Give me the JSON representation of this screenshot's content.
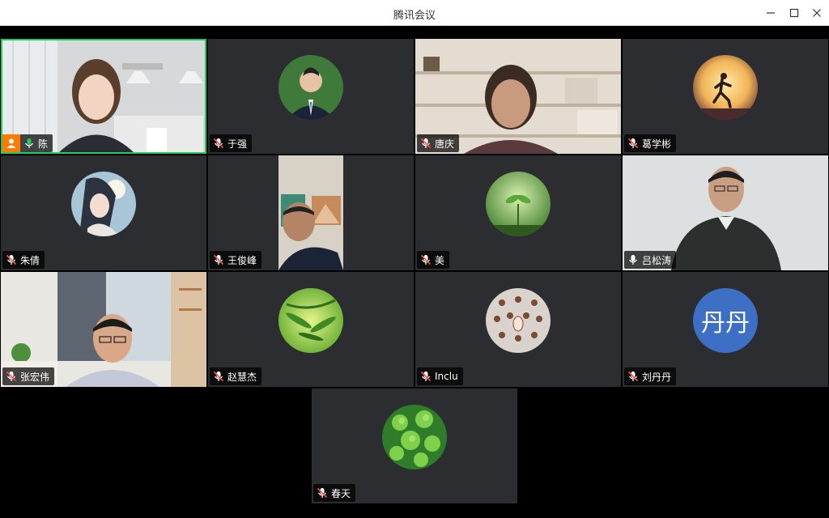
{
  "window": {
    "title": "腾讯会议",
    "minimize": "minimize-icon",
    "maximize": "maximize-icon",
    "close": "close-icon"
  },
  "participants": [
    {
      "name": "陈",
      "mic": "on",
      "host": true,
      "active": true,
      "type": "video"
    },
    {
      "name": "于强",
      "mic": "muted",
      "type": "avatar"
    },
    {
      "name": "唐庆",
      "mic": "muted",
      "type": "video"
    },
    {
      "name": "葛学彬",
      "mic": "muted",
      "type": "avatar"
    },
    {
      "name": "朱倩",
      "mic": "muted",
      "type": "avatar"
    },
    {
      "name": "王俊峰",
      "mic": "muted",
      "type": "video"
    },
    {
      "name": "美",
      "mic": "muted",
      "type": "avatar"
    },
    {
      "name": "吕松涛",
      "mic": "on",
      "type": "video"
    },
    {
      "name": "张宏伟",
      "mic": "muted",
      "type": "video"
    },
    {
      "name": "赵慧杰",
      "mic": "muted",
      "type": "avatar"
    },
    {
      "name": "Inclu",
      "mic": "muted",
      "type": "avatar"
    },
    {
      "name": "刘丹丹",
      "mic": "muted",
      "type": "avatar",
      "initials": "丹丹"
    },
    {
      "name": "春天",
      "mic": "muted",
      "type": "avatar"
    }
  ],
  "colors": {
    "active_border": "#1fce5b",
    "host_badge": "#ff7a00",
    "muted_mic": "#ff4d4f",
    "initials_bg": "#3d6fc4"
  }
}
